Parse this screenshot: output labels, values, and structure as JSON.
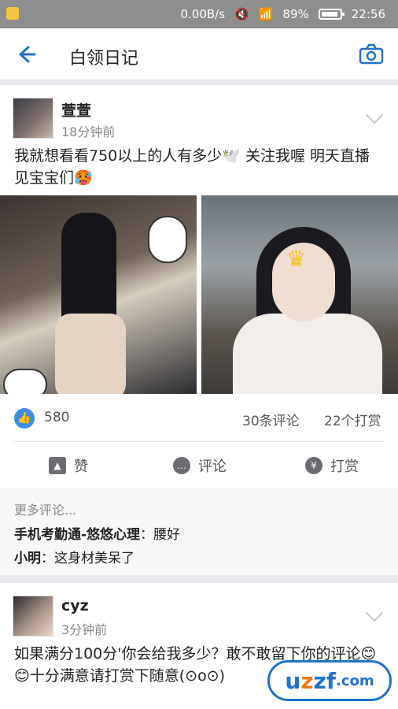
{
  "status_bar": {
    "network_speed": "0.00B/s",
    "battery": "89%",
    "time": "22:56"
  },
  "app_bar": {
    "title": "白领日记"
  },
  "posts": [
    {
      "username": "萱萱",
      "time_ago": "18分钟前",
      "content": "我就想看看750以上的人有多少🕊️ 关注我喔 明天直播见宝宝们🥵",
      "likes": "580",
      "comments": "30条评论",
      "rewards": "22个打赏",
      "actions": {
        "like": "赞",
        "comment": "评论",
        "reward": "打赏"
      },
      "more_comments": "更多评论...",
      "comment_list": [
        {
          "user": "手机考勤通-悠悠心理",
          "text": "腰好"
        },
        {
          "user": "小明",
          "text": "这身材美呆了"
        }
      ]
    },
    {
      "username": "cyz",
      "time_ago": "3分钟前",
      "content": "如果满分100分'你会给我多少？敢不敢留下你的评论😊😊十分满意请打赏下随意(⊙o⊙)"
    }
  ],
  "watermark": {
    "prefix": "u",
    "accent": "z",
    "suffix": "zf",
    "domain": ".com"
  },
  "colors": {
    "accent": "#1f73c9",
    "status_bar": "#8e8e8e",
    "like": "#3d8ee6"
  }
}
